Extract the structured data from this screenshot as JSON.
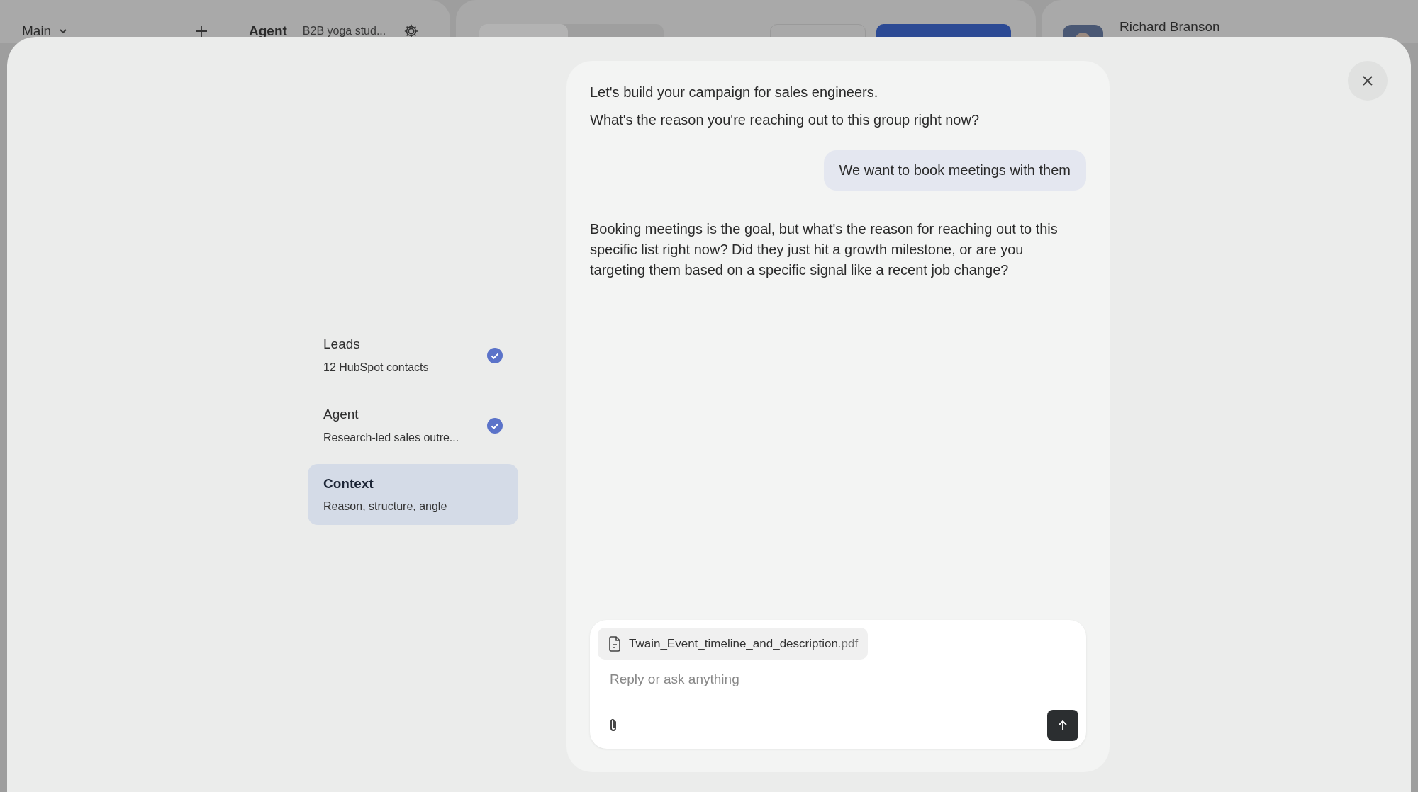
{
  "top_bar": {
    "workspace": "Main",
    "agent_label": "Agent",
    "agent_name": "B2B yoga stud...",
    "user_name": "Richard Branson"
  },
  "steps": [
    {
      "title": "Leads",
      "subtitle": "12 HubSpot contacts",
      "done": true,
      "selected": false
    },
    {
      "title": "Agent",
      "subtitle": "Research-led sales outre...",
      "done": true,
      "selected": false
    },
    {
      "title": "Context",
      "subtitle": "Reason, structure, angle",
      "done": false,
      "selected": true
    }
  ],
  "messages": [
    {
      "kind": "assistant",
      "paragraphs": [
        "Let's build your campaign for sales engineers.",
        "What's the reason you're reaching out to this group right now?"
      ]
    },
    {
      "kind": "user",
      "paragraphs": [
        "We want to book meetings with them"
      ]
    },
    {
      "kind": "assistant",
      "paragraphs": [
        "Booking meetings is the goal, but what's the reason for reaching out to this specific list right now? Did they just hit a growth milestone, or are you targeting them based on a specific signal like a recent job change?"
      ]
    }
  ],
  "composer": {
    "attachment": {
      "name": "Twain_Event_timeline_and_description",
      "extension": ".pdf"
    },
    "placeholder": "Reply or ask anything"
  }
}
